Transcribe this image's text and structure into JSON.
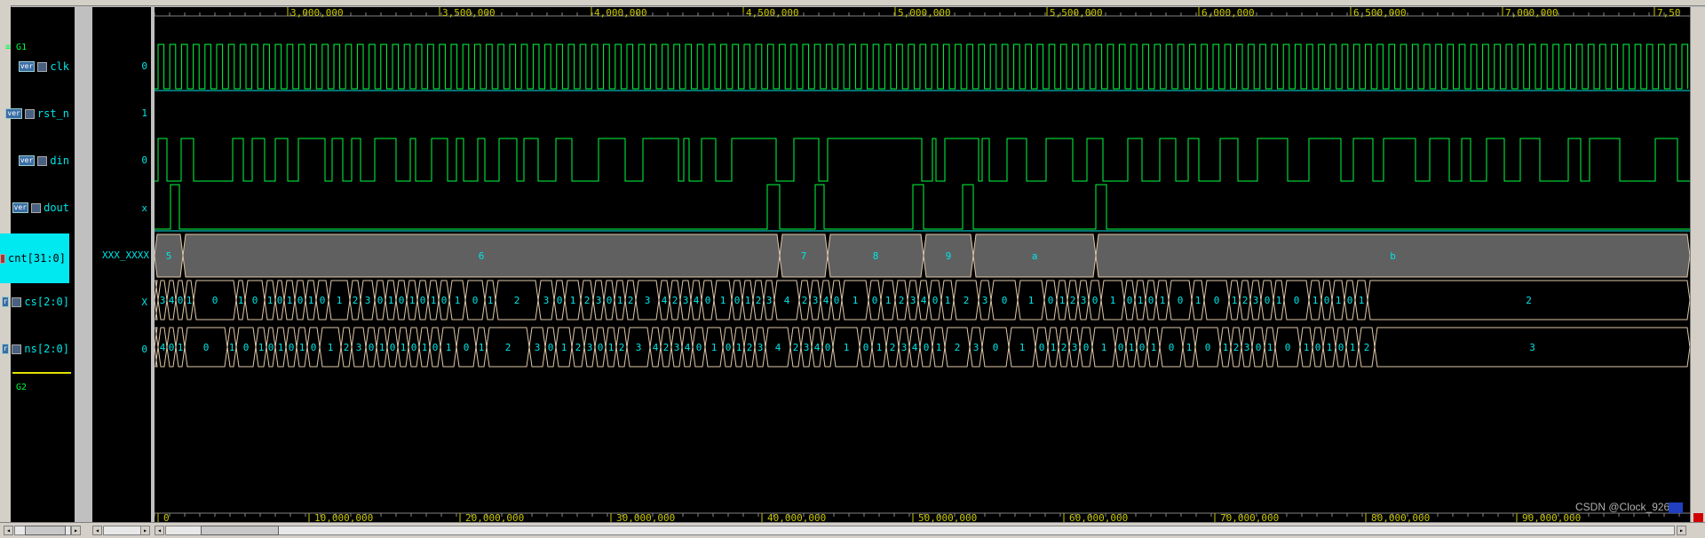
{
  "ruler_top": {
    "labels": [
      "3,000,000",
      "3,500,000",
      "4,000,000",
      "4,500,000",
      "5,000,000",
      "5,500,000",
      "6,000,000",
      "6,500,000",
      "7,000,000",
      "7,50"
    ]
  },
  "ruler_bottom": {
    "labels": [
      "0",
      "10,000,000",
      "20,000,000",
      "30,000,000",
      "40,000,000",
      "50,000,000",
      "60,000,000",
      "70,000,000",
      "80,000,000",
      "90,000,000"
    ]
  },
  "groups": {
    "g1": "G1",
    "g2": "G2"
  },
  "signals": [
    {
      "name": "clk",
      "tag": "ver",
      "value": "0"
    },
    {
      "name": "rst_n",
      "tag": "ver",
      "value": "1"
    },
    {
      "name": "din",
      "tag": "ver",
      "value": "0"
    },
    {
      "name": "dout",
      "tag": "ver",
      "value": "x"
    },
    {
      "name": "cnt[31:0]",
      "tag": "",
      "value": "XXX_XXXX"
    },
    {
      "name": "cs[2:0]",
      "tag": "r",
      "value": "X"
    },
    {
      "name": "ns[2:0]",
      "tag": "r",
      "value": "0"
    }
  ],
  "cnt_segments": [
    "5",
    "6",
    "7",
    "8",
    "9",
    "a",
    "b"
  ],
  "cs_values": [
    "3",
    "4",
    "0",
    "1",
    "0",
    "1",
    "0",
    "1",
    "0",
    "1",
    "0",
    "1",
    "0",
    "1",
    "2",
    "3",
    "0",
    "1",
    "0",
    "1",
    "0",
    "1",
    "0",
    "1",
    "0",
    "1",
    "2",
    "3",
    "0",
    "1",
    "2",
    "3",
    "0",
    "1",
    "2",
    "3",
    "4",
    "2",
    "3",
    "4",
    "0",
    "1",
    "0",
    "1",
    "2",
    "3",
    "4",
    "2",
    "3",
    "4",
    "0",
    "1",
    "0",
    "1",
    "2",
    "3",
    "4",
    "0",
    "1",
    "2",
    "3",
    "0",
    "1",
    "0",
    "1",
    "2",
    "3",
    "0",
    "1",
    "0",
    "1",
    "0",
    "1",
    "0",
    "1",
    "0",
    "1",
    "2",
    "3",
    "0",
    "1",
    "0",
    "1",
    "0",
    "1",
    "0",
    "1",
    "2"
  ],
  "ns_values": [
    "4",
    "0",
    "1",
    "0",
    "1",
    "0",
    "1",
    "0",
    "1",
    "0",
    "1",
    "0",
    "1",
    "2",
    "3",
    "0",
    "1",
    "0",
    "1",
    "0",
    "1",
    "0",
    "1",
    "0",
    "1",
    "2",
    "3",
    "0",
    "1",
    "2",
    "3",
    "0",
    "1",
    "2",
    "3",
    "4",
    "2",
    "3",
    "4",
    "0",
    "1",
    "0",
    "1",
    "2",
    "3",
    "4",
    "2",
    "3",
    "4",
    "0",
    "1",
    "0",
    "1",
    "2",
    "3",
    "4",
    "0",
    "1",
    "2",
    "3",
    "0",
    "1",
    "0",
    "1",
    "2",
    "3",
    "0",
    "1",
    "0",
    "1",
    "0",
    "1",
    "0",
    "1",
    "0",
    "1",
    "2",
    "3",
    "0",
    "1",
    "0",
    "1",
    "0",
    "1",
    "0",
    "1",
    "2",
    "3"
  ],
  "watermark": "CSDN @Clock_926",
  "colors": {
    "wave_green": "#00ff40",
    "wave_cyan": "#00e5e5",
    "bus_fill": "#606060",
    "bus_edge": "#e0c8a8",
    "ruler_text": "#c8c800",
    "selection": "#00e8f0"
  }
}
